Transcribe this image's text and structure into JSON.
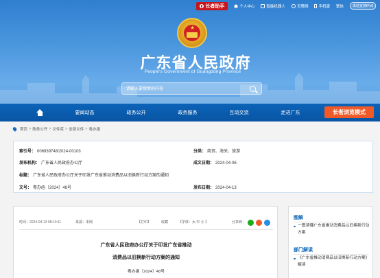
{
  "topbar": {
    "elder_helper": "长者助手",
    "links": [
      "个人中心",
      "智能机器人",
      "无障碍",
      "手机版",
      "繁体"
    ],
    "ipv6": "本站支持IPv6"
  },
  "header": {
    "title": "广东省人民政府",
    "subtitle": "People's Government of Guangdong Province",
    "search_placeholder": "请输入要搜索的内容"
  },
  "nav": {
    "items": [
      "要闻动态",
      "政务公开",
      "政务服务",
      "互动交流",
      "走进广东"
    ],
    "elder_mode": "长者浏览模式"
  },
  "breadcrumb": [
    "首页",
    "政务公开",
    "文件库",
    "全部文件",
    "粤办函"
  ],
  "meta": {
    "index_label": "索引号：",
    "index_value": "006939748/2024-00103",
    "category_label": "分类：",
    "category_value": "商贸、海关、旅游",
    "issuer_label": "发布机构：",
    "issuer_value": "广东省人民政府办公厅",
    "created_label": "成文日期：",
    "created_value": "2024-04-06",
    "title_label": "标题：",
    "title_value": "广东省人民政府办公厅关于印发广东省推动消费品以旧换新行动方案的通知",
    "docno_label": "文号：",
    "docno_value": "粤办函〔2024〕48号",
    "published_label": "发布日期：",
    "published_value": "2024-04-13"
  },
  "article": {
    "time": "时间：2024-04-13 08:10:11",
    "source": "来源：本网",
    "print": "【打印】",
    "favorite": "收藏",
    "font_size": "【字体：大  中  小  】",
    "share": "分享到：",
    "title_line1": "广东省人民政府办公厅关于印发广东省推动",
    "title_line2": "消费品以旧换新行动方案的通知",
    "doc_no": "粤办函〔2024〕48号"
  },
  "sidebar": {
    "section1_title": "图解",
    "section1_link": "一图读懂广东省推动消费品以旧换新行动方案",
    "section2_title": "部门解读",
    "section2_link": "《广东省推动消费品以旧换新行动方案》解读"
  },
  "colors": {
    "header_blue": "#4c97de",
    "nav_blue": "#0b63b8",
    "elder_red": "#c8161d",
    "elder_orange": "#f05a28"
  }
}
